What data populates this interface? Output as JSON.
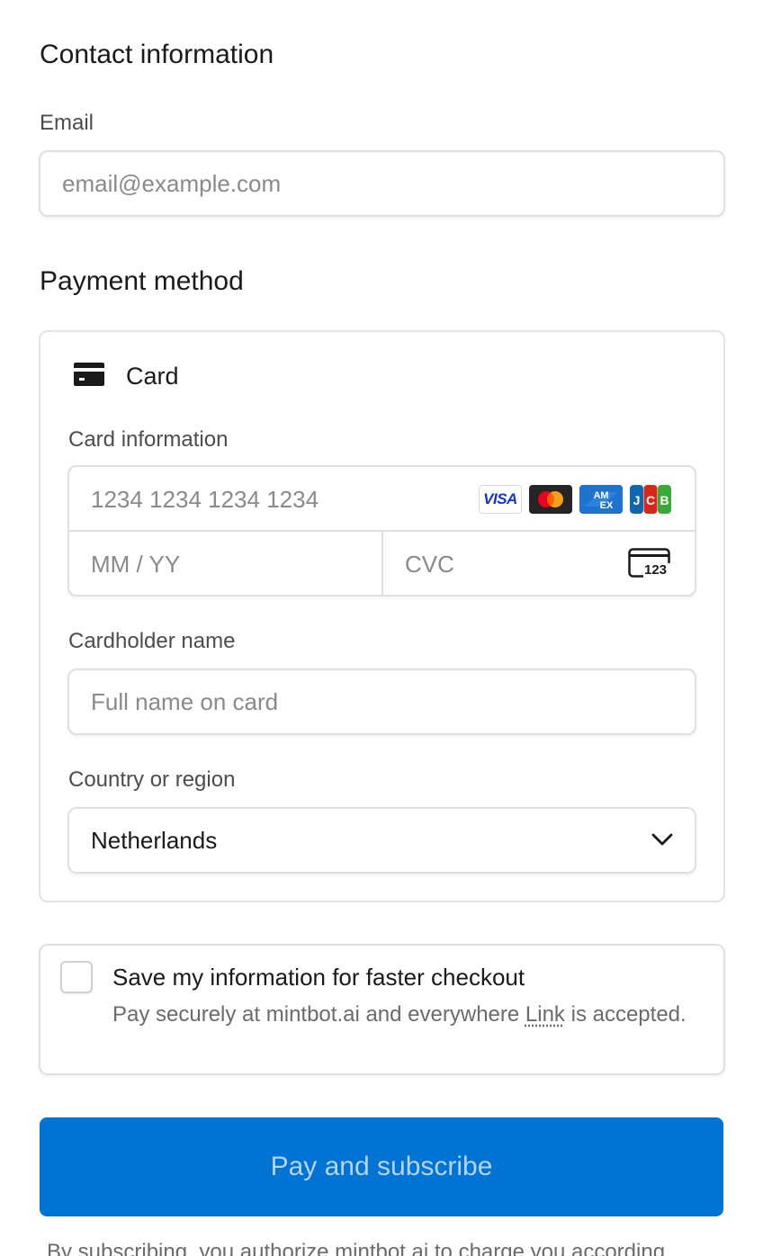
{
  "contact": {
    "title": "Contact information",
    "email_label": "Email",
    "email_placeholder": "email@example.com",
    "email_value": ""
  },
  "payment": {
    "title": "Payment method",
    "method_label": "Card",
    "card_info_label": "Card information",
    "card_number_placeholder": "1234 1234 1234 1234",
    "expiry_placeholder": "MM / YY",
    "cvc_placeholder": "CVC",
    "cvc_icon_text": "123",
    "brands": [
      "visa-icon",
      "mastercard-icon",
      "amex-icon",
      "jcb-icon"
    ],
    "brand_visa_text": "VISA",
    "cardholder_label": "Cardholder name",
    "cardholder_placeholder": "Full name on card",
    "country_label": "Country or region",
    "country_value": "Netherlands"
  },
  "save_info": {
    "title": "Save my information for faster checkout",
    "desc_before": "Pay securely at mintbot.ai and everywhere ",
    "desc_link": "Link",
    "desc_after": " is accepted.",
    "checked": false
  },
  "pay_button": {
    "label": "Pay and subscribe"
  },
  "terms": {
    "text": "By subscribing, you authorize mintbot.ai to charge you according"
  },
  "colors": {
    "primary": "#0074d4",
    "button_text": "#b7d3f3",
    "border": "#e0e0e0"
  }
}
